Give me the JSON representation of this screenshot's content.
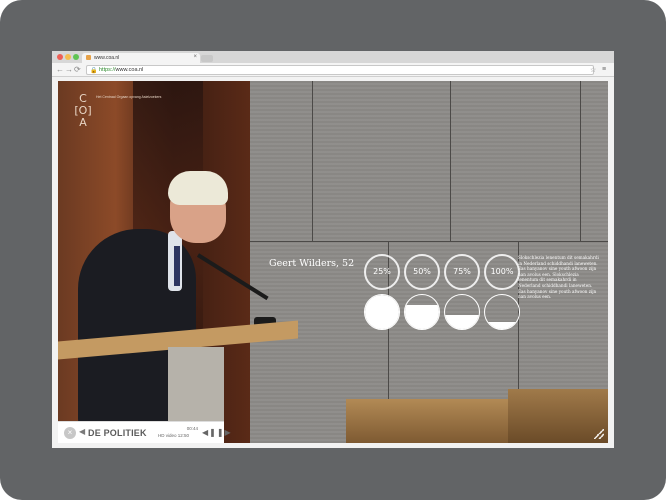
{
  "browser": {
    "tab_title": "www.coa.nl",
    "url_scheme": "https://",
    "url_rest": "www.coa.nl",
    "tab_close": "×",
    "back": "←",
    "forward": "→",
    "reload": "⟳",
    "star": "☆",
    "menu": "≡"
  },
  "site": {
    "logo_lines": [
      "C",
      "[O]",
      "A"
    ],
    "tagline": "Het Centraal Orgaan opvang Asielzoekers"
  },
  "colors": {
    "dot_red": "#ed5f56",
    "dot_yellow": "#f5bd4f",
    "dot_green": "#5fc454",
    "accent_white": "#ffffff"
  },
  "profile": {
    "name": "Geert Wilders, 52",
    "percent_labels": [
      "25%",
      "50%",
      "75%",
      "100%"
    ],
    "fill_levels": [
      1.0,
      0.7,
      0.4,
      0.2
    ],
    "description": "Slokschlezia lenentum dit semakahrdi in Nederland schiddhandi laneweten. Eas hanyanov sine youth afwoon zijn nan avolus een. Slokschlezia lenentum dit semakahrdi in Nederland schiddhandi laneweten. Eas hanyanov sine youth afwoon zijn nan avolus een."
  },
  "player": {
    "close": "×",
    "prev": "◀",
    "title": "DE POLITIEK",
    "time_current": "00:44",
    "time_total": "12:50",
    "hd_label": "HD video",
    "controls": "◀❚❚▶"
  }
}
